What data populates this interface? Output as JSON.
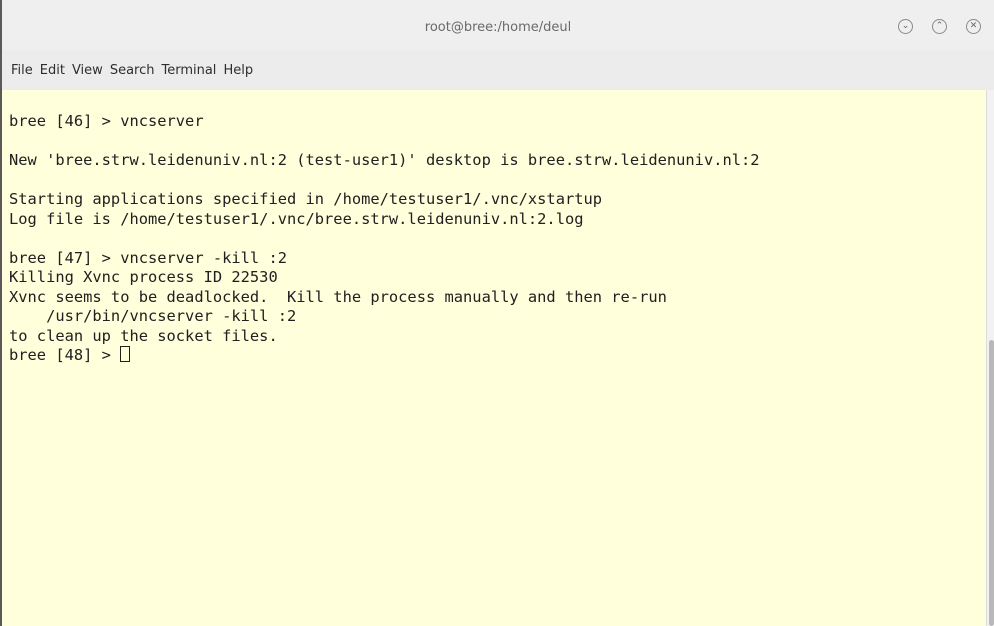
{
  "window": {
    "title": "root@bree:/home/deul"
  },
  "menu": [
    "File",
    "Edit",
    "View",
    "Search",
    "Terminal",
    "Help"
  ],
  "terminal": {
    "lines": [
      "bree [46] > vncserver",
      "",
      "New 'bree.strw.leidenuniv.nl:2 (test-user1)' desktop is bree.strw.leidenuniv.nl:2",
      "",
      "Starting applications specified in /home/testuser1/.vnc/xstartup",
      "Log file is /home/testuser1/.vnc/bree.strw.leidenuniv.nl:2.log",
      "",
      "bree [47] > vncserver -kill :2",
      "Killing Xvnc process ID 22530",
      "Xvnc seems to be deadlocked.  Kill the process manually and then re-run",
      "    /usr/bin/vncserver -kill :2",
      "to clean up the socket files."
    ],
    "prompt": "bree [48] > "
  },
  "icons": {
    "minimize": "chevron-down-icon",
    "maximize": "chevron-up-icon",
    "close": "close-icon"
  },
  "colors": {
    "terminal_background": "#ffffdc",
    "terminal_text": "#202020",
    "titlebar_background": "#efefef"
  }
}
